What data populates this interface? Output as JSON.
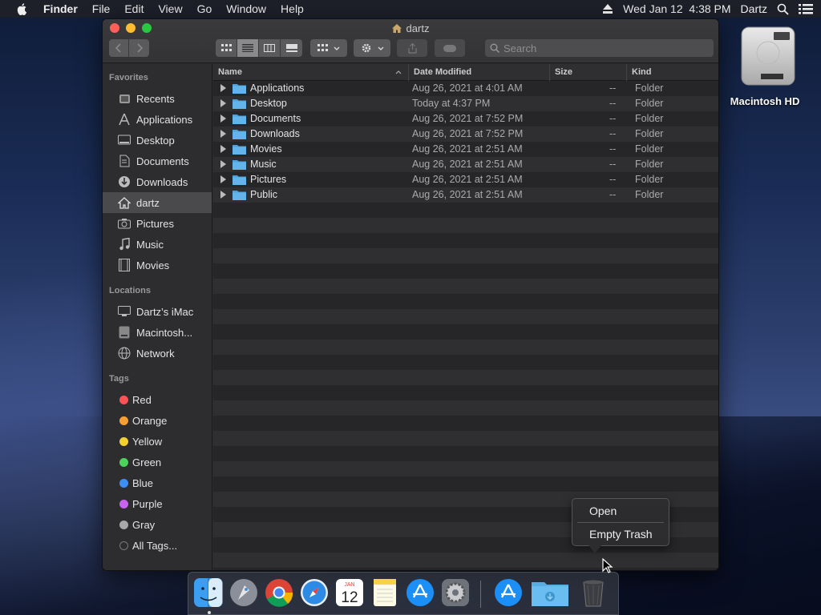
{
  "menubar": {
    "items": [
      "Finder",
      "File",
      "Edit",
      "View",
      "Go",
      "Window",
      "Help"
    ],
    "datetime": "Wed Jan 12  4:38 PM",
    "user": "Dartz"
  },
  "window": {
    "title": "dartz",
    "search_placeholder": "Search"
  },
  "sidebar": {
    "favorites_header": "Favorites",
    "favorites": [
      "Recents",
      "Applications",
      "Desktop",
      "Documents",
      "Downloads",
      "dartz",
      "Pictures",
      "Music",
      "Movies"
    ],
    "locations_header": "Locations",
    "locations": [
      "Dartz’s iMac",
      "Macintosh...",
      "Network"
    ],
    "tags_header": "Tags",
    "tags": [
      {
        "label": "Red",
        "color": "#ff5257"
      },
      {
        "label": "Orange",
        "color": "#f7a031"
      },
      {
        "label": "Yellow",
        "color": "#f5d130"
      },
      {
        "label": "Green",
        "color": "#4cd35c"
      },
      {
        "label": "Blue",
        "color": "#3d8ff5"
      },
      {
        "label": "Purple",
        "color": "#c863f0"
      },
      {
        "label": "Gray",
        "color": "#a8a8a8"
      },
      {
        "label": "All Tags...",
        "color": "#555555"
      }
    ]
  },
  "columns": {
    "name": "Name",
    "date": "Date Modified",
    "size": "Size",
    "kind": "Kind"
  },
  "files": [
    {
      "name": "Applications",
      "date": "Aug 26, 2021 at 4:01 AM",
      "size": "--",
      "kind": "Folder"
    },
    {
      "name": "Desktop",
      "date": "Today at 4:37 PM",
      "size": "--",
      "kind": "Folder"
    },
    {
      "name": "Documents",
      "date": "Aug 26, 2021 at 7:52 PM",
      "size": "--",
      "kind": "Folder"
    },
    {
      "name": "Downloads",
      "date": "Aug 26, 2021 at 7:52 PM",
      "size": "--",
      "kind": "Folder"
    },
    {
      "name": "Movies",
      "date": "Aug 26, 2021 at 2:51 AM",
      "size": "--",
      "kind": "Folder"
    },
    {
      "name": "Music",
      "date": "Aug 26, 2021 at 2:51 AM",
      "size": "--",
      "kind": "Folder"
    },
    {
      "name": "Pictures",
      "date": "Aug 26, 2021 at 2:51 AM",
      "size": "--",
      "kind": "Folder"
    },
    {
      "name": "Public",
      "date": "Aug 26, 2021 at 2:51 AM",
      "size": "--",
      "kind": "Folder"
    }
  ],
  "desktop": {
    "hd_label": "Macintosh HD"
  },
  "context_menu": {
    "open": "Open",
    "empty_trash": "Empty Trash"
  },
  "dock": {
    "calendar_month": "JAN",
    "calendar_day": "12"
  }
}
